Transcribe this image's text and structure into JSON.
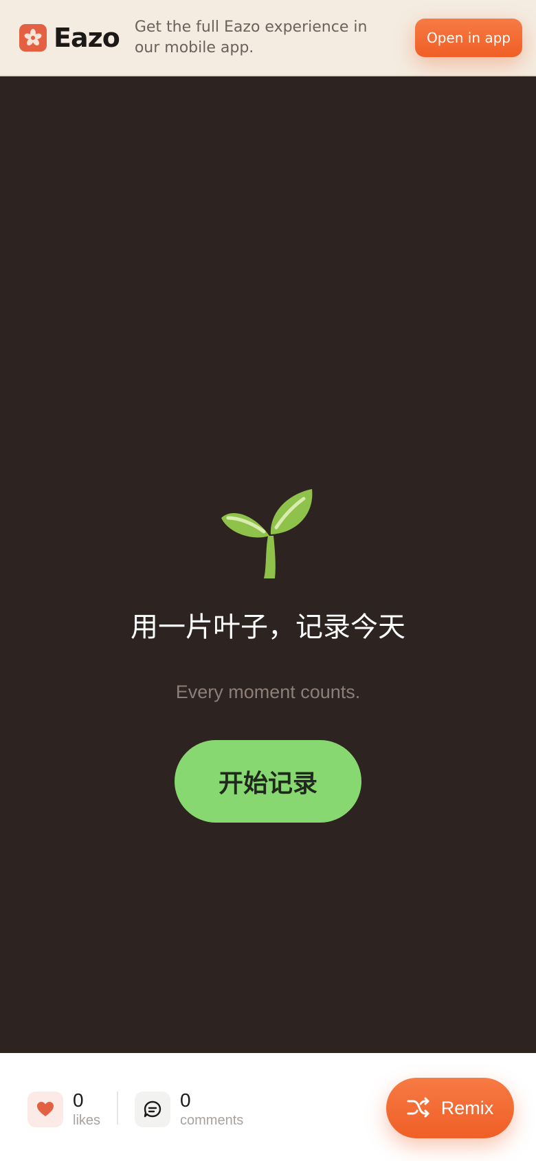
{
  "banner": {
    "brand_name": "Eazo",
    "message": "Get the full Eazo experience in our mobile app.",
    "open_label": "Open in app",
    "brand_icon": "eazo-logo-icon"
  },
  "main": {
    "illustration_icon": "sprout-icon",
    "headline": "用一片叶子，记录今天",
    "subline": "Every moment counts.",
    "start_label": "开始记录"
  },
  "stats": {
    "likes": {
      "count": "0",
      "label": "likes",
      "icon": "heart-icon"
    },
    "comments": {
      "count": "0",
      "label": "comments",
      "icon": "comment-icon"
    }
  },
  "remix": {
    "label": "Remix",
    "icon": "shuffle-icon"
  },
  "colors": {
    "accent": "#ef5f26",
    "background": "#2d2321",
    "banner_bg": "#f4ece1",
    "start_button": "#88d872",
    "brand_mark": "#e46043"
  }
}
